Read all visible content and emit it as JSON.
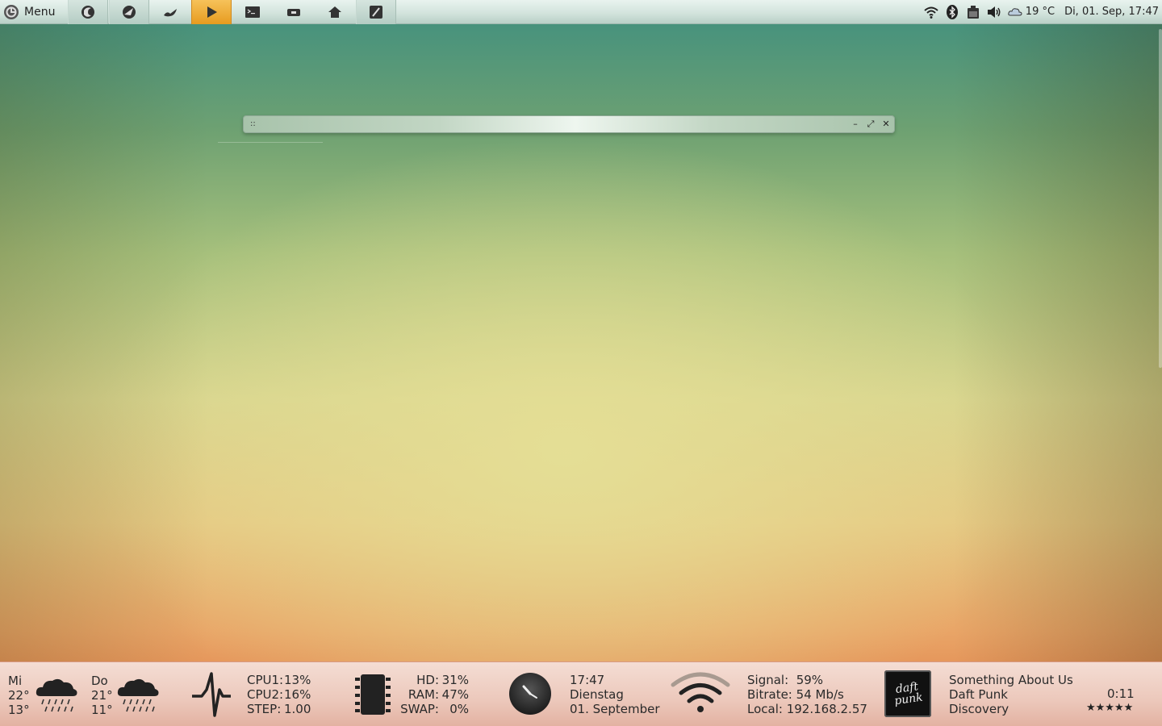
{
  "top_panel": {
    "menu_label": "Menu",
    "launchers": [
      {
        "icon": "firefox-icon"
      },
      {
        "icon": "thunderbird-icon"
      },
      {
        "icon": "gimp-icon"
      },
      {
        "icon": "media-player-icon"
      },
      {
        "icon": "terminal-icon"
      },
      {
        "icon": "pendrive-icon"
      },
      {
        "icon": "home-folder-icon"
      },
      {
        "icon": "text-editor-icon"
      }
    ],
    "tray": {
      "temperature": "19 °C",
      "clock": "Di, 01. Sep, 17:47"
    }
  },
  "window": {
    "grip": "::",
    "minimize": "–",
    "maximize": "⤢",
    "close": "✕"
  },
  "weather": {
    "day1": {
      "name": "Mi",
      "high": "22°",
      "low": "13°"
    },
    "day2": {
      "name": "Do",
      "high": "21°",
      "low": "11°"
    }
  },
  "cpu": {
    "cpu1_label": "CPU1:",
    "cpu1_value": "13%",
    "cpu2_label": "CPU2:",
    "cpu2_value": "16%",
    "step_label": "STEP:",
    "step_value": "1.00"
  },
  "memory": {
    "hd_label": "HD:",
    "hd_value": "31%",
    "ram_label": "RAM:",
    "ram_value": "47%",
    "swap_label": "SWAP:",
    "swap_value": "0%"
  },
  "datetime": {
    "time": "17:47",
    "weekday": "Dienstag",
    "date": "01. September"
  },
  "network": {
    "signal_label": "Signal:",
    "signal_value": "59%",
    "bitrate_label": "Bitrate:",
    "bitrate_value": "54 Mb/s",
    "local_label": "Local:",
    "local_value": "192.168.2.57"
  },
  "music": {
    "album_art_text": "daft punk",
    "title": "Something About Us",
    "artist": "Daft Punk",
    "album": "Discovery",
    "elapsed": "0:11",
    "rating": "★★★★★"
  }
}
